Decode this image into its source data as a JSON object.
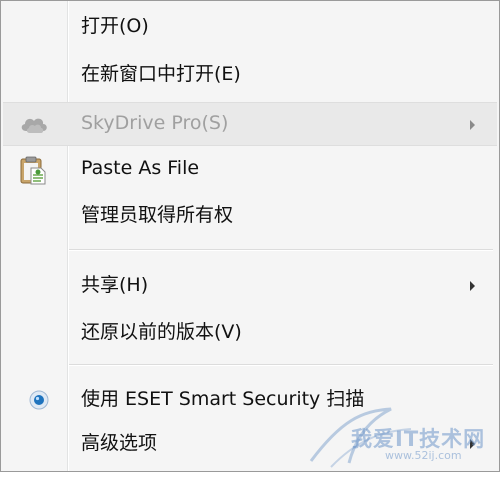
{
  "menu": {
    "items": [
      {
        "label": "打开(O)"
      },
      {
        "label": "在新窗口中打开(E)"
      },
      {
        "label": "SkyDrive Pro(S)",
        "disabled": true,
        "submenu": true,
        "icon": "cloud-icon"
      },
      {
        "label": "Paste As File",
        "icon": "clipboard-icon"
      },
      {
        "label": "管理员取得所有权"
      },
      {
        "label": "共享(H)",
        "submenu": true
      },
      {
        "label": "还原以前的版本(V)"
      },
      {
        "label": "使用 ESET Smart Security 扫描",
        "icon": "eset-icon"
      },
      {
        "label": "高级选项",
        "submenu": true
      }
    ]
  },
  "watermark": {
    "text": "我爱IT技术网",
    "url": "www.52ij.com"
  },
  "colors": {
    "menu_bg": "#f5f5f5",
    "text": "#111111",
    "disabled_text": "#a0a0a0",
    "eset_blue": "#1e73be"
  }
}
